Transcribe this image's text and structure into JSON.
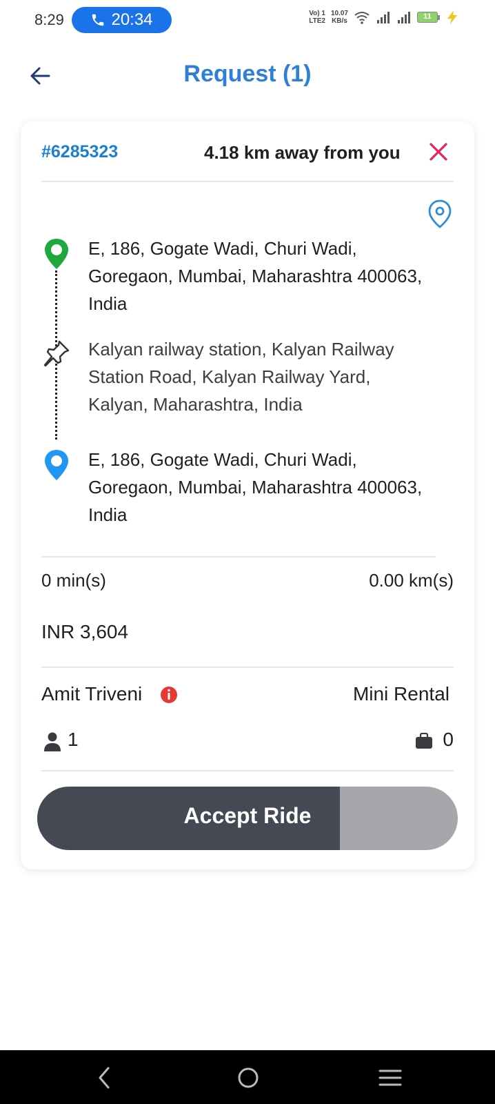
{
  "status_bar": {
    "time": "8:29",
    "call_timer": "20:34",
    "network_label": "Vo) 1\nLTE2",
    "speed_value": "10.07",
    "speed_unit": "KB/s",
    "battery": "11",
    "icons": [
      "phone-icon",
      "wifi-icon",
      "signal-icon",
      "signal-icon",
      "battery-icon",
      "charging-icon"
    ]
  },
  "header": {
    "title": "Request (1)",
    "back_icon": "arrow-left-icon"
  },
  "request": {
    "ride_id": "#6285323",
    "distance_away": "4.18 km away from you",
    "close_icon": "close-icon",
    "map_icon": "location-pin-icon",
    "stops": [
      {
        "type": "pickup",
        "icon": "green-location-icon",
        "address": "E, 186, Gogate Wadi, Churi Wadi, Goregaon, Mumbai, Maharashtra 400063, India"
      },
      {
        "type": "waypoint",
        "icon": "pushpin-icon",
        "address": "Kalyan railway station, Kalyan Railway Station Road, Kalyan Railway Yard, Kalyan, Maharashtra, India"
      },
      {
        "type": "drop",
        "icon": "blue-location-icon",
        "address": "E, 186, Gogate Wadi, Churi Wadi, Goregaon, Mumbai, Maharashtra 400063, India"
      }
    ],
    "duration": "0 min(s)",
    "distance": "0.00 km(s)",
    "fare": "INR 3,604",
    "rider_name": "Amit Triveni",
    "ride_type": "Mini Rental",
    "passengers": "1",
    "luggage": "0",
    "accept_label": "Accept Ride",
    "accept_progress": 0.72
  },
  "colors": {
    "accent": "#2f7fd6",
    "ride_id": "#1a7fd1",
    "close": "#e5245b",
    "pickup": "#1fa83c",
    "drop": "#2196f3",
    "info": "#e53935",
    "button_fill": "#454954",
    "button_track": "#a5a7aa"
  }
}
